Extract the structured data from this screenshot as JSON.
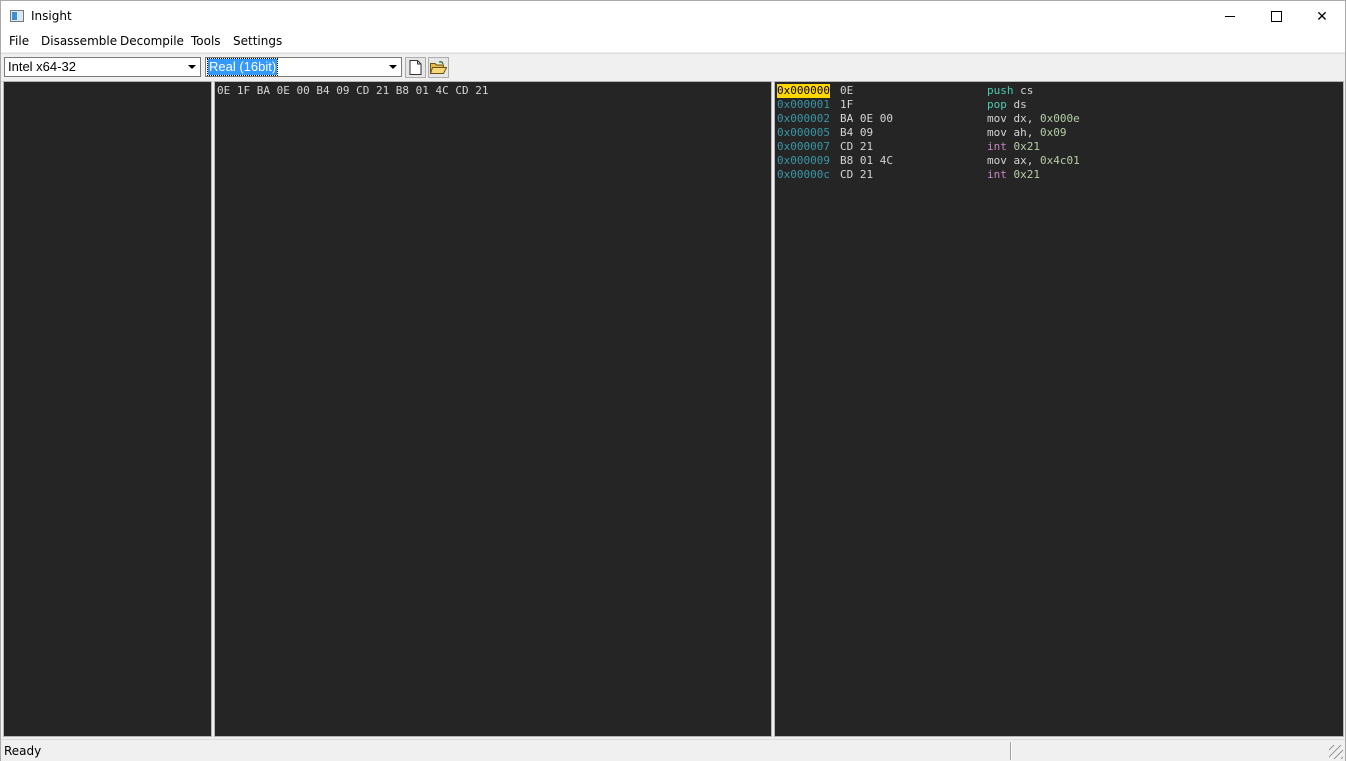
{
  "window": {
    "title": "Insight",
    "app_icon": "app-window-icon"
  },
  "menu": [
    "File",
    "Disassemble",
    "Decompile",
    "Tools",
    "Settings"
  ],
  "toolbar": {
    "arch_select": "Intel x64-32",
    "mode_select": "Real (16bit)",
    "buttons": [
      "new-file-icon",
      "open-folder-icon"
    ]
  },
  "hex_view": {
    "text": "0E 1F BA 0E 00 B4 09 CD 21 B8 01 4C CD 21"
  },
  "disassembly": [
    {
      "addr": "0x000000",
      "bytes": "0E",
      "mnemonic": "push",
      "operands": "cs",
      "imm": "",
      "kind": "stack",
      "highlighted": true
    },
    {
      "addr": "0x000001",
      "bytes": "1F",
      "mnemonic": "pop",
      "operands": "ds",
      "imm": "",
      "kind": "stack",
      "highlighted": false
    },
    {
      "addr": "0x000002",
      "bytes": "BA 0E 00",
      "mnemonic": "mov",
      "operands": "dx, ",
      "imm": "0x000e",
      "kind": "mov",
      "highlighted": false
    },
    {
      "addr": "0x000005",
      "bytes": "B4 09",
      "mnemonic": "mov",
      "operands": "ah, ",
      "imm": "0x09",
      "kind": "mov",
      "highlighted": false
    },
    {
      "addr": "0x000007",
      "bytes": "CD 21",
      "mnemonic": "int",
      "operands": "",
      "imm": "0x21",
      "kind": "int",
      "highlighted": false
    },
    {
      "addr": "0x000009",
      "bytes": "B8 01 4C",
      "mnemonic": "mov",
      "operands": "ax, ",
      "imm": "0x4c01",
      "kind": "mov",
      "highlighted": false
    },
    {
      "addr": "0x00000c",
      "bytes": "CD 21",
      "mnemonic": "int",
      "operands": "",
      "imm": "0x21",
      "kind": "int",
      "highlighted": false
    }
  ],
  "status": {
    "text": "Ready"
  },
  "colors": {
    "pane_bg": "#252526",
    "address": "#3a96a5",
    "address_highlight": "#ffd700",
    "mnemonic_stack": "#4ec9b0",
    "mnemonic_int": "#c586c0",
    "immediate": "#b5cea8"
  }
}
